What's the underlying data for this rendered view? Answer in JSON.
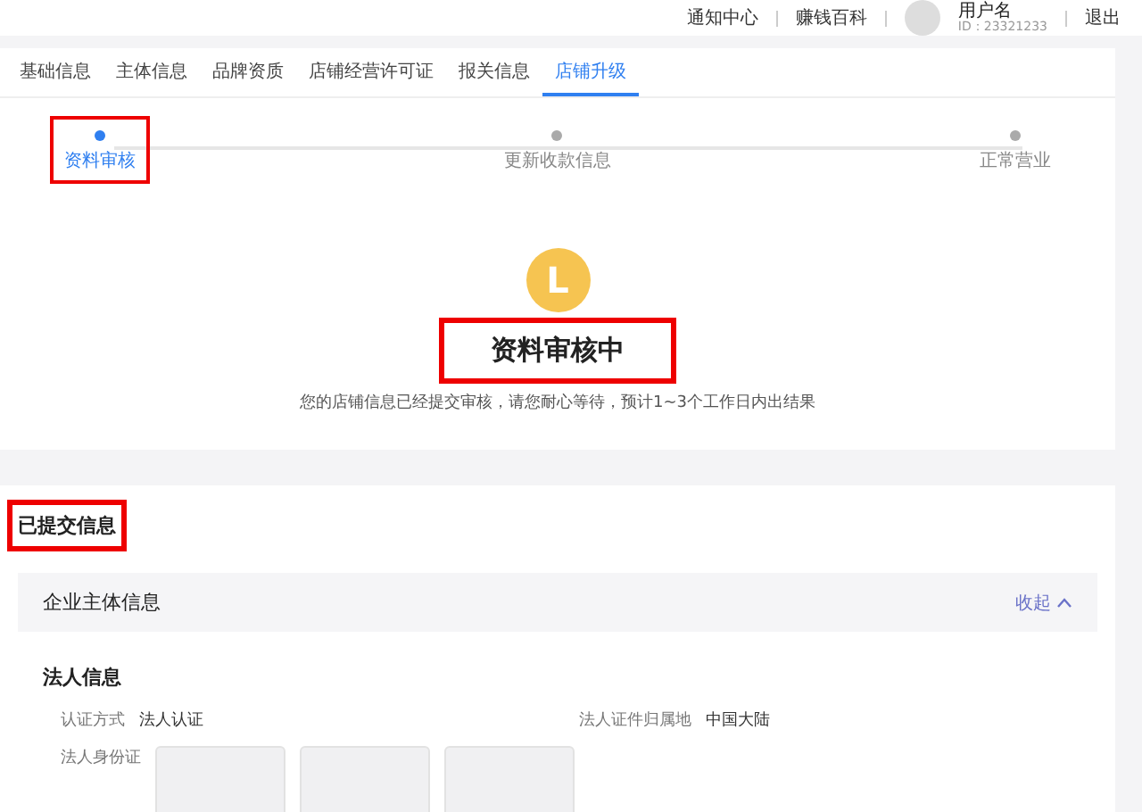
{
  "header": {
    "links": [
      "通知中心",
      "赚钱百科"
    ],
    "user": {
      "name": "用户名",
      "id": "ID：23321233"
    },
    "logout": "退出"
  },
  "tabs": [
    {
      "label": "基础信息",
      "selected": false
    },
    {
      "label": "主体信息",
      "selected": false
    },
    {
      "label": "品牌资质",
      "selected": false
    },
    {
      "label": "店铺经营许可证",
      "selected": false
    },
    {
      "label": "报关信息",
      "selected": false
    },
    {
      "label": "店铺升级",
      "selected": true
    }
  ],
  "steps": [
    {
      "label": "资料审核",
      "selected": true,
      "highlighted": true
    },
    {
      "label": "更新收款信息",
      "selected": false,
      "highlighted": false
    },
    {
      "label": "正常营业",
      "selected": false,
      "highlighted": false
    }
  ],
  "status": {
    "icon_letter": "L",
    "title": "资料审核中",
    "title_highlighted": true,
    "message": "您的店铺信息已经提交审核，请您耐心等待，预计1~3个工作日内出结果"
  },
  "submitted": {
    "heading": "已提交信息",
    "heading_highlighted": true,
    "panel": {
      "title": "企业主体信息",
      "toggle": "收起",
      "expanded": true
    },
    "section_title": "法人信息",
    "fields": [
      {
        "label": "认证方式",
        "value": "法人认证"
      },
      {
        "label": "法人证件归属地",
        "value": "中国大陆"
      }
    ],
    "id_card": {
      "label": "法人身份证"
    }
  }
}
